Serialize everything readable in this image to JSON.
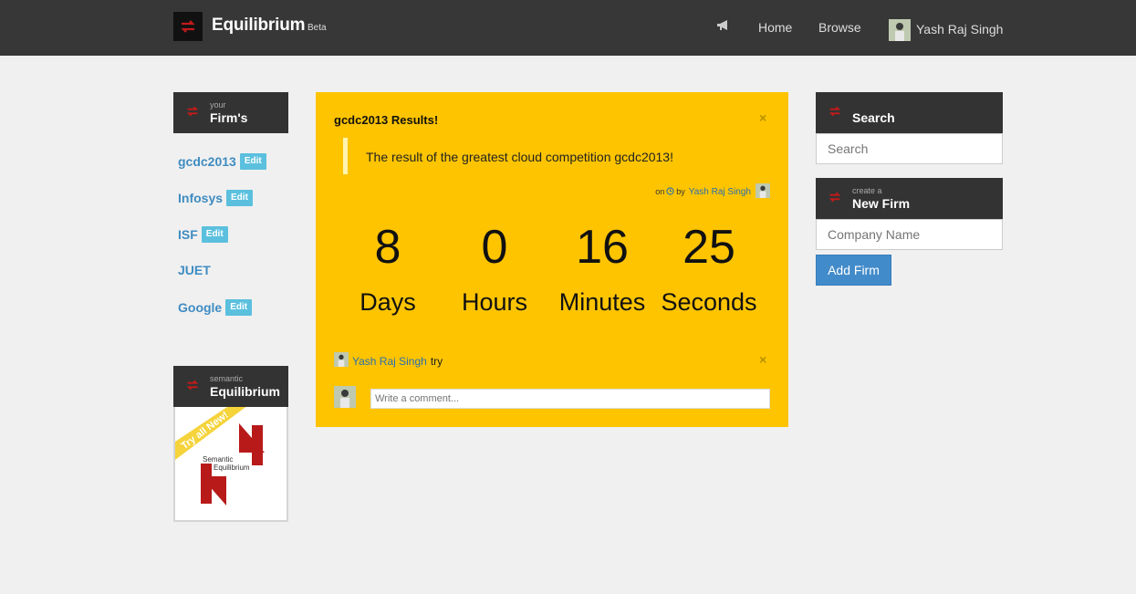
{
  "nav": {
    "brand": "Equilibrium",
    "beta": "Beta",
    "links": [
      "Home",
      "Browse"
    ],
    "user": "Yash Raj Singh"
  },
  "firms_panel": {
    "small": "your",
    "title": "Firm's",
    "items": [
      {
        "name": "gcdc2013",
        "edit": "Edit"
      },
      {
        "name": "Infosys",
        "edit": "Edit"
      },
      {
        "name": "ISF",
        "edit": "Edit"
      },
      {
        "name": "JUET",
        "edit": ""
      },
      {
        "name": "Google",
        "edit": "Edit"
      }
    ]
  },
  "semantic_panel": {
    "small": "semantic",
    "title": "Equilibrium",
    "ribbon": "Try all New!",
    "logo_text_1": "Semantic",
    "logo_text_2": "Equilibrium"
  },
  "post": {
    "title": "gcdc2013 Results!",
    "close": "×",
    "quote": "The result of the greatest cloud competition gcdc2013!",
    "byline_on": "on",
    "byline_by": "by",
    "author": "Yash Raj Singh",
    "countdown": [
      {
        "value": "8",
        "label": "Days"
      },
      {
        "value": "0",
        "label": "Hours"
      },
      {
        "value": "16",
        "label": "Minutes"
      },
      {
        "value": "25",
        "label": "Seconds"
      }
    ],
    "comment": {
      "author": "Yash Raj Singh",
      "text": "try",
      "close": "×"
    },
    "comment_placeholder": "Write a comment..."
  },
  "search_panel": {
    "title": "Search",
    "placeholder": "Search"
  },
  "new_firm_panel": {
    "small": "create a",
    "title": "New Firm",
    "placeholder": "Company Name",
    "button": "Add Firm"
  },
  "colors": {
    "navbar": "#373737",
    "card": "#fec400",
    "link": "#3f8cc2",
    "badge": "#5bc0de",
    "button": "#428bca",
    "logo_red": "#c41a1a"
  }
}
